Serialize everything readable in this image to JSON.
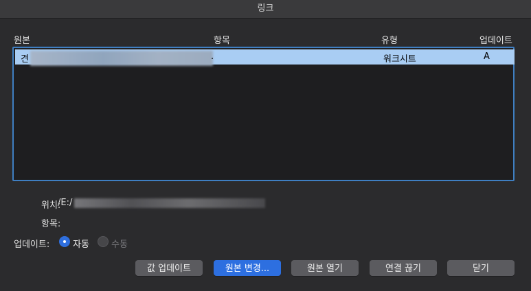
{
  "window": {
    "title": "링크"
  },
  "table": {
    "headers": {
      "source": "원본",
      "item": "항목",
      "type": "유형",
      "update": "업데이트"
    },
    "rows": [
      {
        "source": "견",
        "item": ".",
        "type": "워크시트",
        "update": "A"
      }
    ]
  },
  "details": {
    "location_label": "위치:",
    "location_value": "/E:/",
    "item_label": "항목:",
    "update_label": "업데이트:",
    "options": [
      {
        "label": "자동",
        "selected": true,
        "enabled": true
      },
      {
        "label": "수동",
        "selected": false,
        "enabled": false
      }
    ]
  },
  "buttons": {
    "update_values": "값 업데이트",
    "change_source": "원본 변경...",
    "open_source": "원본 열기",
    "break_link": "연결 끊기",
    "close": "닫기"
  },
  "colors": {
    "accent": "#2d6fe0",
    "selection": "#a9cdf3",
    "table_border": "#3f7fc2"
  }
}
